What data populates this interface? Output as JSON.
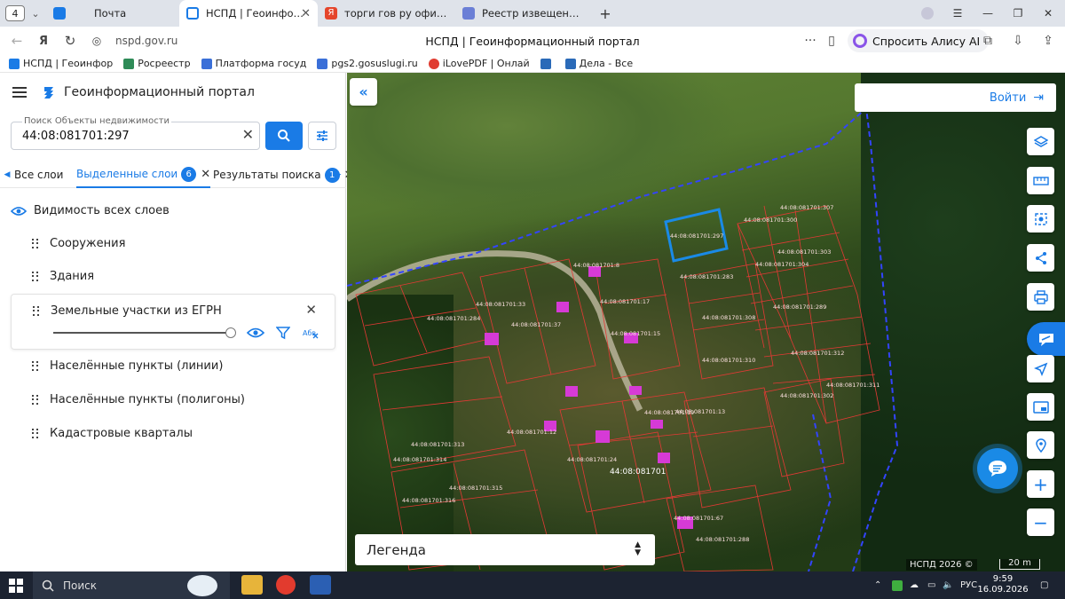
{
  "browser": {
    "tab_count": "4",
    "tabs": [
      {
        "label": "Почта",
        "color": "#1a7be6"
      },
      {
        "label": "НСПД | Геоинформац",
        "color": "#1a7be6"
      },
      {
        "label": "торги гов ру официальн",
        "color": "#e5452b"
      },
      {
        "label": "Реестр извещений",
        "color": "#6b7fd6"
      }
    ],
    "url": "nspd.gov.ru",
    "page_title": "НСПД | Геоинформационный портал",
    "alice_label": "Спросить Алису AI"
  },
  "bookmarks": [
    {
      "label": "НСПД | Геоинфор",
      "color": "#1a7be6"
    },
    {
      "label": "Росреестр",
      "color": "#2e8b57"
    },
    {
      "label": "Платформа госуд",
      "color": "#3a6fd8"
    },
    {
      "label": "pgs2.gosuslugi.ru",
      "color": "#3a6fd8"
    },
    {
      "label": "iLovePDF | Онлай",
      "color": "#e03c31"
    },
    {
      "label": "",
      "color": "#2a6ab8"
    },
    {
      "label": "Дела - Все",
      "color": "#2a6ab8"
    }
  ],
  "sidebar": {
    "title": "Геоинформационный портал",
    "search": {
      "placeholder": "Поиск Объекты недвижимости",
      "value": "44:08:081701:297"
    },
    "tabs": {
      "all": "Все слои",
      "selected": "Выделенные слои",
      "selected_count": "6",
      "results": "Результаты поиска",
      "results_count": "1"
    },
    "visibility_all": "Видимость всех слоев",
    "layers": [
      "Сооружения",
      "Здания",
      "Земельные участки из ЕГРН",
      "Населённые пункты (линии)",
      "Населённые пункты (полигоны)",
      "Кадастровые кварталы"
    ],
    "opacity_percent": 100
  },
  "map": {
    "login_label": "Войти",
    "legend_label": "Легенда",
    "copyright": "НСПД 2026 ©",
    "scale": "20 m",
    "quarter_label": "44:08:081701",
    "selected_parcel": "44:08:081701:297",
    "parcel_labels": [
      "44:08:081701:297",
      "44:08:081701:300",
      "44:08:081701:307",
      "44:08:081701:304",
      "44:08:081701:303",
      "44:08:081701:8",
      "44:08:081701:283",
      "44:08:081701:17",
      "44:08:081701:33",
      "44:08:081701:284",
      "44:08:081701:37",
      "44:08:081701:15",
      "44:08:081701:308",
      "44:08:081701:289",
      "44:08:081701:312",
      "44:08:081701:310",
      "44:08:081701:311",
      "44:08:081701:19",
      "44:08:081701:13",
      "44:08:081701:302",
      "44:08:081701:12",
      "44:08:081701:24",
      "44:08:081701:313",
      "44:08:081701:314",
      "44:08:081701:315",
      "44:08:081701:316",
      "44:08:081701:67",
      "44:08:081701:288"
    ],
    "accent_color": "#1a7be6",
    "parcel_color": "#e53935"
  },
  "taskbar": {
    "search": "Поиск",
    "lang": "РУС",
    "time": "9:59",
    "date": "16.09.2026"
  }
}
